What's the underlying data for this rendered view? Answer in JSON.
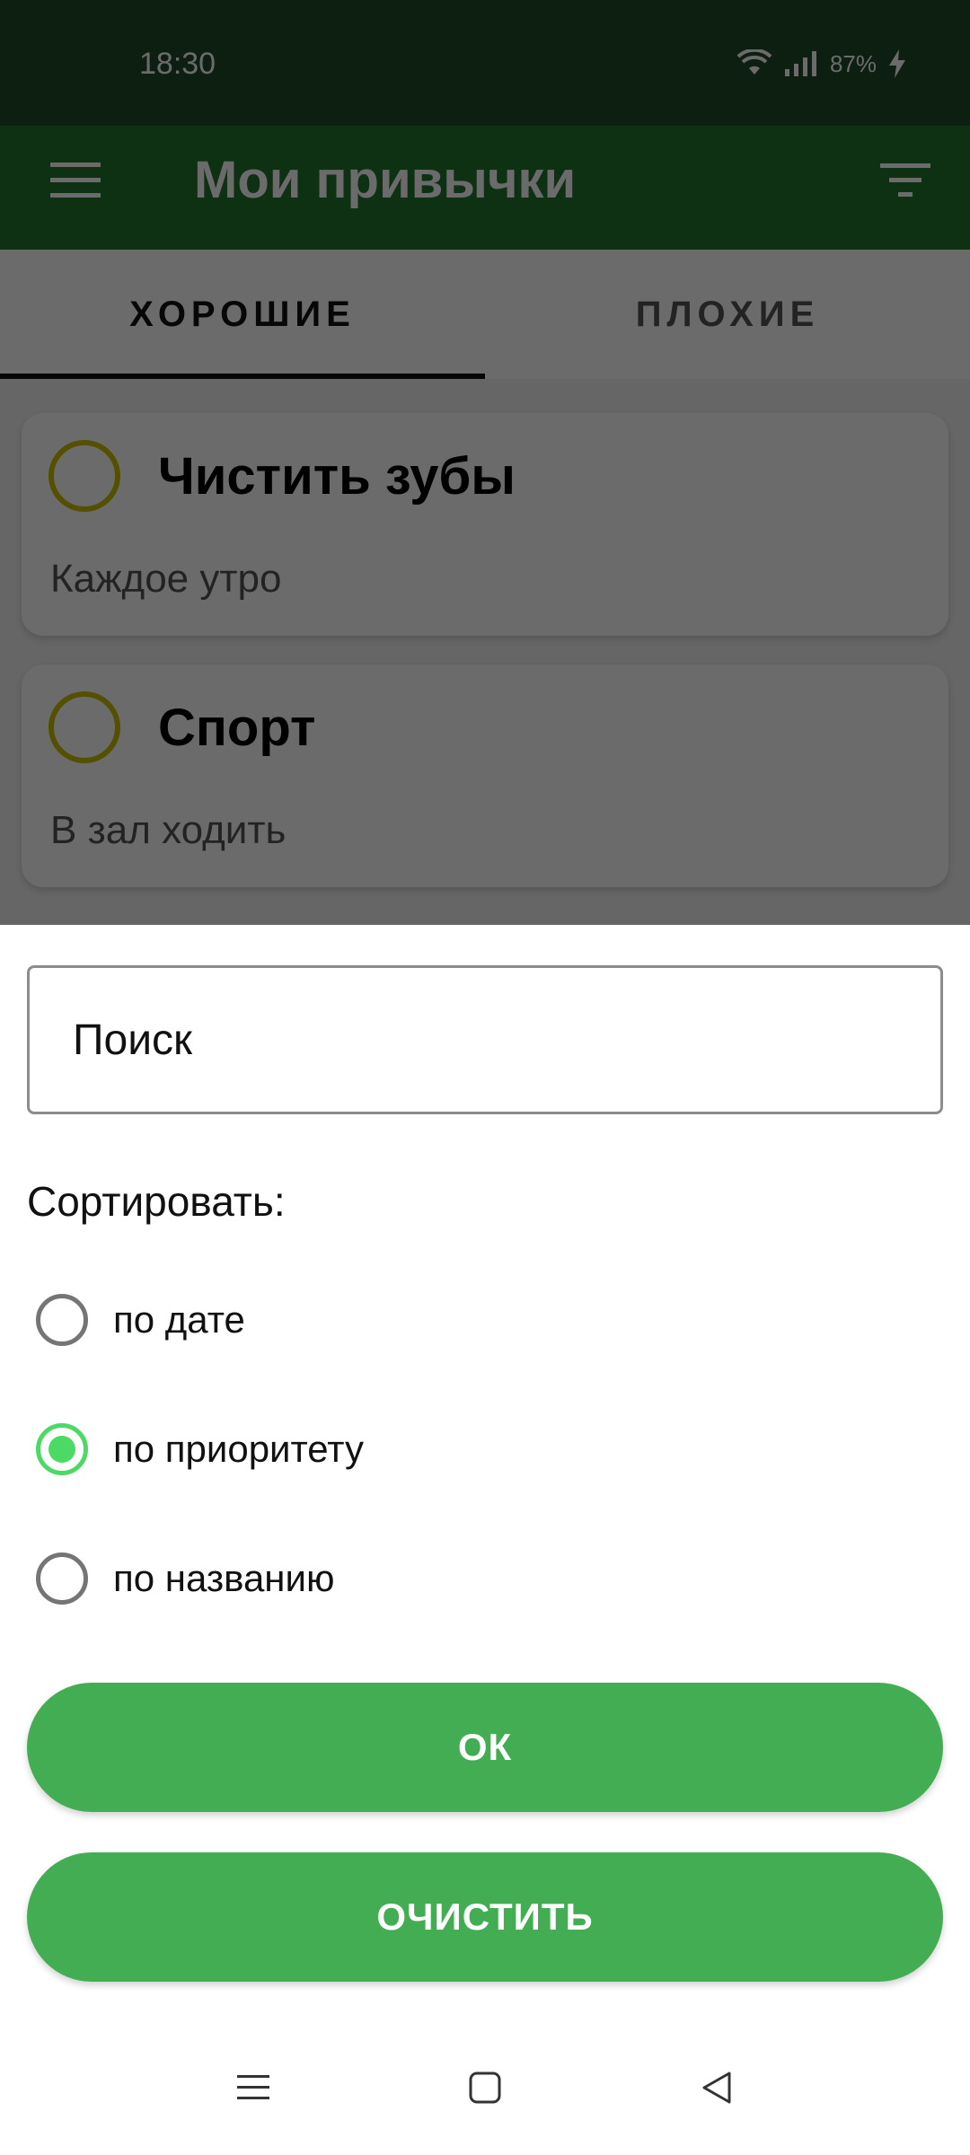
{
  "status_bar": {
    "time": "18:30",
    "battery": "87%",
    "icons": [
      "wifi-icon",
      "signal-icon",
      "battery-charging-icon"
    ]
  },
  "app_bar": {
    "title": "Мои привычки",
    "menu_icon": "hamburger-menu-icon",
    "filter_icon": "filter-icon"
  },
  "tabs": [
    {
      "label": "ХОРОШИЕ",
      "selected": true
    },
    {
      "label": "ПЛОХИЕ",
      "selected": false
    }
  ],
  "habits": [
    {
      "title": "Чистить зубы",
      "description": "Каждое утро"
    },
    {
      "title": "Спорт",
      "description": "В зал ходить"
    }
  ],
  "sheet": {
    "search_placeholder": "Поиск",
    "sort_label": "Сортировать:",
    "sort_options": [
      {
        "label": "по дате",
        "checked": false
      },
      {
        "label": "по приоритету",
        "checked": true
      },
      {
        "label": "по названию",
        "checked": false
      }
    ],
    "ok_label": "ОК",
    "clear_label": "ОЧИСТИТЬ"
  },
  "colors": {
    "status_bar": "#1d4a26",
    "app_bar": "#22762e",
    "accent_button": "#43ad53",
    "radio_checked": "#4cd964",
    "habit_circle": "#c8bf00"
  },
  "nav_bar": {
    "icons": [
      "recents-icon",
      "home-icon",
      "back-icon"
    ]
  }
}
